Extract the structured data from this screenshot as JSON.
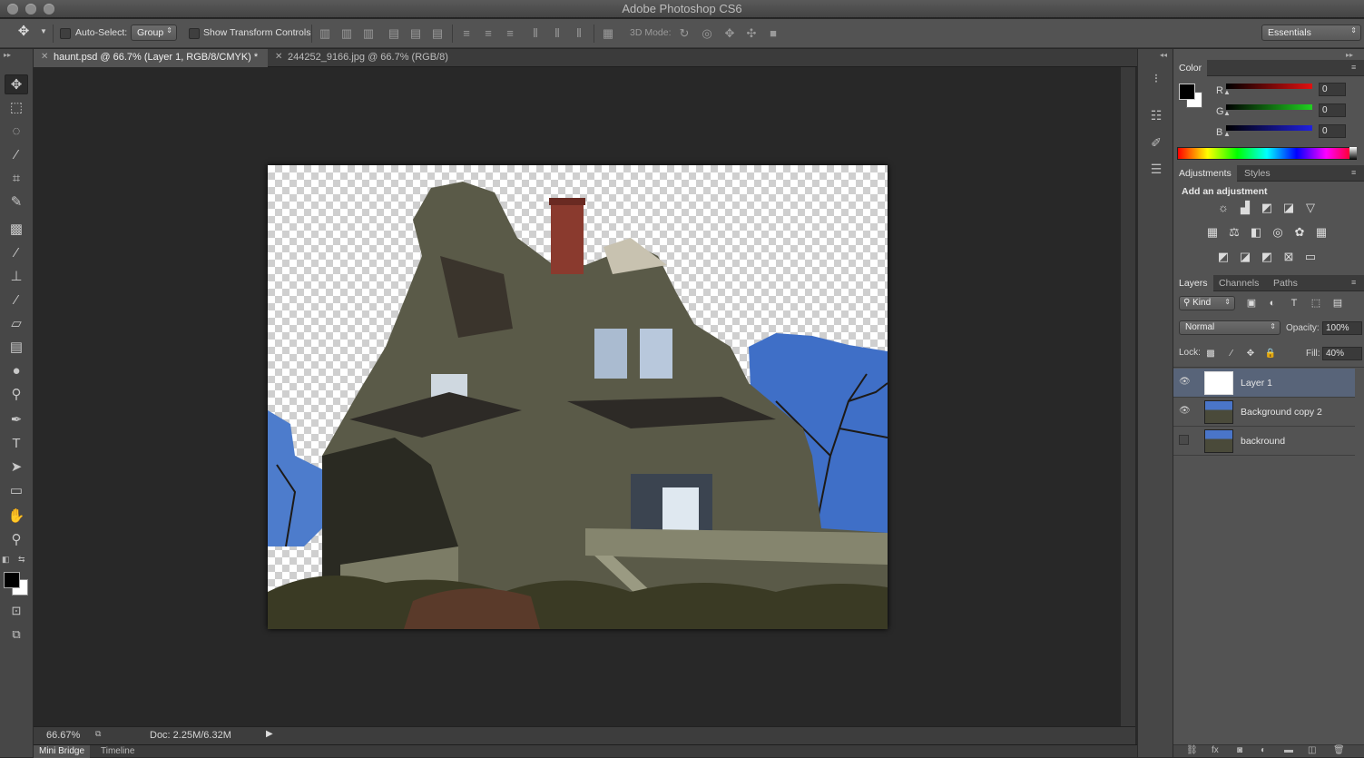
{
  "app": {
    "title": "Adobe Photoshop CS6"
  },
  "options": {
    "auto_select_label": "Auto-Select:",
    "auto_select_value": "Group",
    "transform_label": "Show Transform Controls",
    "mode3d_label": "3D Mode:",
    "workspace": "Essentials"
  },
  "tabs": [
    {
      "label": "haunt.psd @ 66.7% (Layer 1, RGB/8/CMYK) *",
      "active": true
    },
    {
      "label": "244252_9166.jpg @ 66.7% (RGB/8)",
      "active": false
    }
  ],
  "status": {
    "zoom": "66.67%",
    "doc": "Doc: 2.25M/6.32M"
  },
  "bottom_tabs": [
    "Mini Bridge",
    "Timeline"
  ],
  "color_panel": {
    "tab": "Color",
    "channels": [
      {
        "label": "R",
        "value": "0",
        "color": "#d01010"
      },
      {
        "label": "G",
        "value": "0",
        "color": "#20c020"
      },
      {
        "label": "B",
        "value": "0",
        "color": "#2020d0"
      }
    ]
  },
  "adjustments_panel": {
    "tabs": [
      "Adjustments",
      "Styles"
    ],
    "heading": "Add an adjustment",
    "icons_row1": [
      "brightness-icon",
      "levels-icon",
      "curves-icon",
      "exposure-icon",
      "vibrance-icon"
    ],
    "icons_row2": [
      "hue-sat-icon",
      "color-balance-icon",
      "bw-icon",
      "photo-filter-icon",
      "channel-mixer-icon",
      "color-lookup-icon"
    ],
    "icons_row3": [
      "invert-icon",
      "posterize-icon",
      "threshold-icon",
      "selective-color-icon",
      "gradient-map-icon"
    ]
  },
  "layers_panel": {
    "tabs": [
      "Layers",
      "Channels",
      "Paths"
    ],
    "filter": "Kind",
    "blend_mode": "Normal",
    "opacity_label": "Opacity:",
    "opacity": "100%",
    "lock_label": "Lock:",
    "fill_label": "Fill:",
    "fill": "40%",
    "layers": [
      {
        "name": "Layer 1",
        "visible": true,
        "selected": true
      },
      {
        "name": "Background copy 2",
        "visible": true,
        "selected": false
      },
      {
        "name": "backround",
        "visible": false,
        "selected": false
      }
    ]
  }
}
